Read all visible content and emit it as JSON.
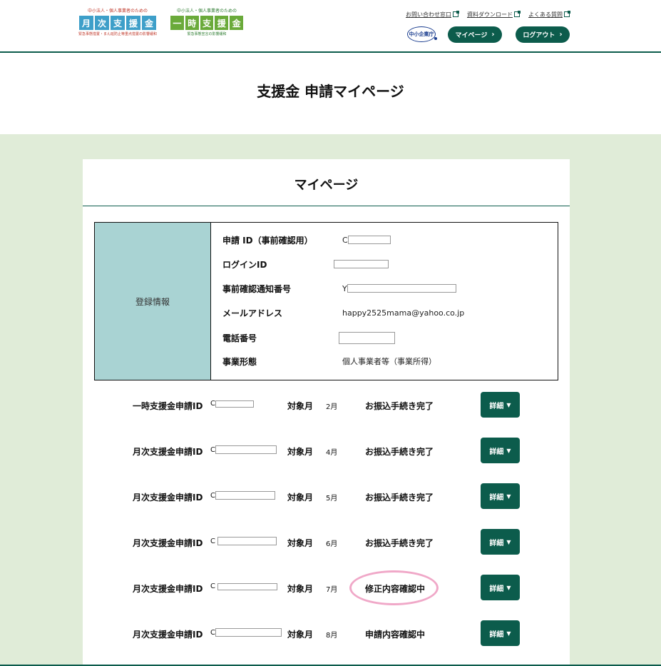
{
  "header": {
    "logo_monthly": {
      "small_text": "中小法人・個人事業者のための",
      "chars": [
        "月",
        "次",
        "支",
        "援",
        "金"
      ],
      "sub_text": "緊急事態措置・まん延防止等重点措置の影響緩和",
      "color": "#3e9fc9"
    },
    "logo_temporary": {
      "small_text": "中小法人・個人事業者のための",
      "chars": [
        "一",
        "時",
        "支",
        "援",
        "金"
      ],
      "sub_text": "緊急事態宣言の影響緩和",
      "color": "#6aaa3a"
    },
    "links": {
      "contact": "お問い合わせ窓口",
      "downloads": "資料ダウンロード",
      "faq": "よくある質問"
    },
    "agency": "中小企業庁",
    "mypage_button": "マイページ",
    "logout_button": "ログアウト"
  },
  "page_title": "支援金 申請マイページ",
  "card": {
    "title": "マイページ",
    "registration": {
      "label": "登録情報",
      "rows": [
        {
          "key": "申請 ID（事前確認用）",
          "prefix": "C",
          "value": ""
        },
        {
          "key": "ログインID",
          "prefix": "",
          "value": ""
        },
        {
          "key": "事前確認通知番号",
          "prefix": "Y",
          "value": ""
        },
        {
          "key": "メールアドレス",
          "prefix": "",
          "value": "happy2525mama@yahoo.co.jp"
        },
        {
          "key": "電話番号",
          "prefix": "",
          "value": ""
        },
        {
          "key": "事業形態",
          "prefix": "",
          "value": "個人事業者等（事業所得）"
        }
      ]
    },
    "applications": [
      {
        "label": "一時支援金申請ID",
        "prefix": "C",
        "month_label": "対象月",
        "month": "2月",
        "status": "お振込手続き完了",
        "button": "詳細"
      },
      {
        "label": "月次支援金申請ID",
        "prefix": "C",
        "month_label": "対象月",
        "month": "4月",
        "status": "お振込手続き完了",
        "button": "詳細"
      },
      {
        "label": "月次支援金申請ID",
        "prefix": "C",
        "month_label": "対象月",
        "month": "5月",
        "status": "お振込手続き完了",
        "button": "詳細"
      },
      {
        "label": "月次支援金申請ID",
        "prefix": "C",
        "month_label": "対象月",
        "month": "6月",
        "status": "お振込手続き完了",
        "button": "詳細"
      },
      {
        "label": "月次支援金申請ID",
        "prefix": "C",
        "month_label": "対象月",
        "month": "7月",
        "status": "修正内容確認中",
        "button": "詳細"
      },
      {
        "label": "月次支援金申請ID",
        "prefix": "C",
        "month_label": "対象月",
        "month": "8月",
        "status": "申請内容確認中",
        "button": "詳細"
      }
    ]
  },
  "colors": {
    "brand": "#0c5c4c",
    "background_green": "#e0ecd8",
    "registration_label_bg": "#a9d3d3",
    "highlight_circle": "#f0a8c8"
  }
}
